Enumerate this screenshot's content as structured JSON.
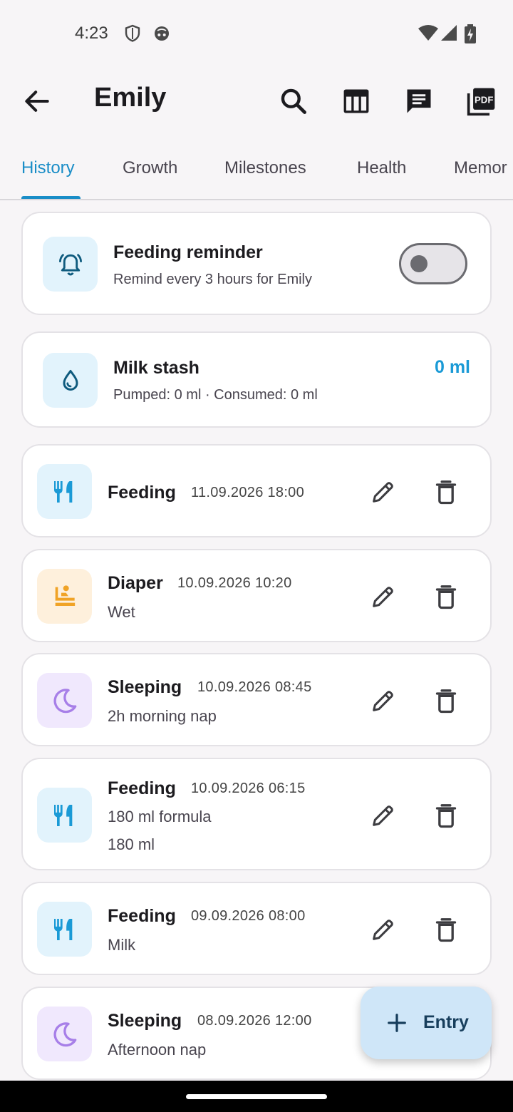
{
  "status_bar": {
    "time": "4:23"
  },
  "app_bar": {
    "title": "Emily",
    "icons": [
      "back-arrow-icon",
      "search-icon",
      "table-icon",
      "chat-icon",
      "pdf-icon"
    ]
  },
  "tabs": [
    {
      "label": "History",
      "active": true
    },
    {
      "label": "Growth",
      "active": false
    },
    {
      "label": "Milestones",
      "active": false
    },
    {
      "label": "Health",
      "active": false
    },
    {
      "label": "Memor",
      "active": false
    }
  ],
  "reminder": {
    "title": "Feeding reminder",
    "subtitle": "Remind every 3 hours for Emily",
    "enabled": false
  },
  "stash": {
    "title": "Milk stash",
    "subtitle": "Pumped: 0 ml · Consumed: 0 ml",
    "value": "0 ml"
  },
  "entries": [
    {
      "type": "Feeding",
      "date": "11.09.2026 18:00",
      "lines": [],
      "icon": "fork-knife-icon"
    },
    {
      "type": "Diaper",
      "date": "10.09.2026 10:20",
      "lines": [
        "Wet"
      ],
      "icon": "baby-changing-icon"
    },
    {
      "type": "Sleeping",
      "date": "10.09.2026 08:45",
      "lines": [
        "2h morning nap"
      ],
      "icon": "moon-icon"
    },
    {
      "type": "Feeding",
      "date": "10.09.2026 06:15",
      "lines": [
        "180 ml formula",
        "180 ml"
      ],
      "icon": "fork-knife-icon"
    },
    {
      "type": "Feeding",
      "date": "09.09.2026 08:00",
      "lines": [
        "Milk"
      ],
      "icon": "fork-knife-icon"
    },
    {
      "type": "Sleeping",
      "date": "08.09.2026 12:00",
      "lines": [
        "Afternoon nap"
      ],
      "icon": "moon-icon"
    }
  ],
  "fab": {
    "label": "Entry"
  },
  "colors": {
    "accent": "#1a8dc7",
    "feeding": "#1a9ad6",
    "diaper": "#f0a326",
    "sleep": "#a77fe8"
  }
}
